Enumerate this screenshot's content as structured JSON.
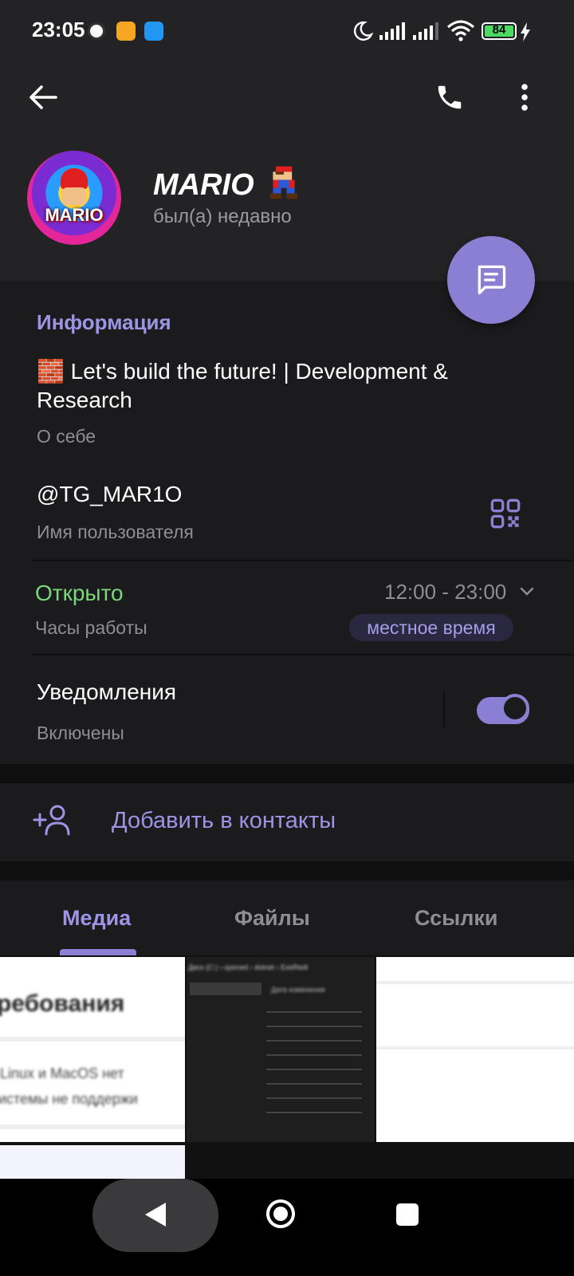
{
  "status_bar": {
    "time": "23:05",
    "battery": "84"
  },
  "profile": {
    "name": "MARIO",
    "avatar_text": "MARIO",
    "status": "был(а) недавно"
  },
  "info": {
    "section_title": "Информация",
    "bio": "🧱 Let's build the future! | Development & Research",
    "bio_label": "О себе",
    "username": "@TG_MAR1O",
    "username_label": "Имя пользователя",
    "hours_status": "Открыто",
    "hours_label": "Часы работы",
    "hours_value": "12:00 - 23:00",
    "timezone_chip": "местное время",
    "notifications_title": "Уведомления",
    "notifications_status": "Включены"
  },
  "actions": {
    "add_contact": "Добавить в контакты"
  },
  "tabs": [
    {
      "label": "Медиа",
      "active": true
    },
    {
      "label": "Файлы",
      "active": false
    },
    {
      "label": "Ссылки",
      "active": false
    }
  ],
  "media_thumbs": [
    {
      "line1": "ребования",
      "line2": "Linux и MacOS нет",
      "line3": "истемы не поддержи"
    },
    {
      "header": "Диск (C:) › opened › dotnet › ExeRedl",
      "col": "Дата изменения"
    },
    {}
  ],
  "colors": {
    "accent": "#8b7fd4",
    "open_green": "#7cd67b",
    "background": "#1b1b1d",
    "header_bg": "#232325"
  }
}
